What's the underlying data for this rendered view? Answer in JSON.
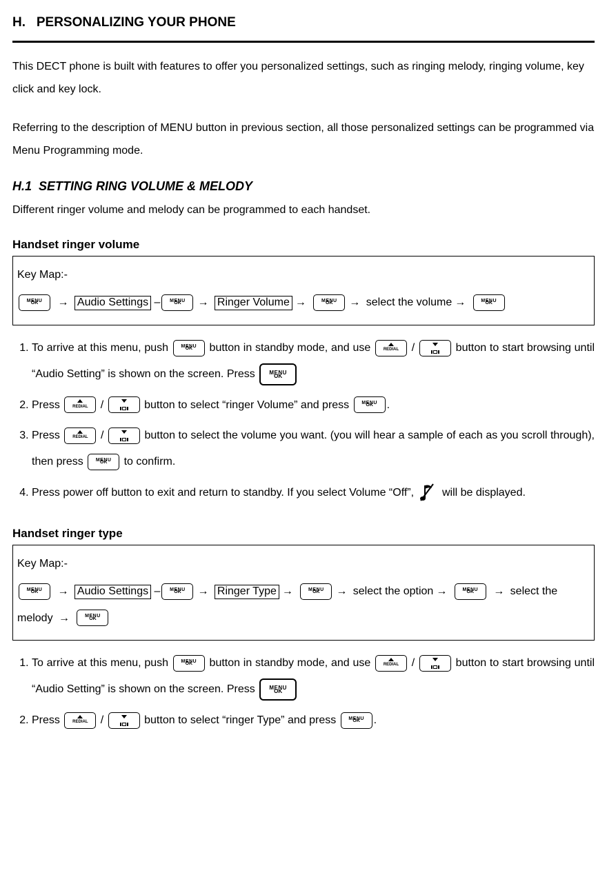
{
  "section": {
    "letter": "H.",
    "title": "PERSONALIZING YOUR PHONE"
  },
  "intro1": "This DECT phone is built with features to offer you personalized settings, such as ringing melody, ringing volume, key click and key lock.",
  "intro2": "Referring to the description of MENU button in previous section, all those personalized settings can be programmed via Menu Programming mode.",
  "h1": {
    "num": "H.1",
    "title": "SETTING RING VOLUME & MELODY",
    "desc": "Different ringer volume and melody can be programmed to each handset."
  },
  "ringerVolume": {
    "heading": "Handset ringer volume",
    "keymapLabel": "Key Map:-",
    "flow": {
      "audioSettings": "Audio Settings",
      "ringerVolume": "Ringer Volume",
      "selectVolume": "select the volume"
    },
    "steps": {
      "s1a": "To arrive at this menu, push ",
      "s1b": " button in standby mode, and use ",
      "s1c": " button to start browsing until “Audio Setting” is shown on the screen. Press ",
      "s2a": "Press ",
      "s2b": "  button to select “ringer Volume” and press ",
      "s3a": "Press ",
      "s3b": " button to select the volume you want. (you will hear a sample of each as you scroll through), then press ",
      "s3c": " to confirm.",
      "s4a": "Press power off button to exit and return to standby. If you select Volume “Off”, ",
      "s4b": " will be displayed."
    }
  },
  "ringerType": {
    "heading": "Handset ringer type",
    "keymapLabel": "Key Map:-",
    "flow": {
      "audioSettings": "Audio Settings",
      "ringerType": "Ringer Type",
      "selectOption": "select the option",
      "selectMelody": "select the melody "
    },
    "steps": {
      "s1a": "To arrive at this menu, push ",
      "s1b": " button in standby mode, and use ",
      "s1c": " button to start browsing until “Audio Setting” is shown on the screen. Press ",
      "s2a": "Press ",
      "s2b": " button to select “ringer Type” and press "
    }
  },
  "slash": " / ",
  "period": ".",
  "dash": " –"
}
